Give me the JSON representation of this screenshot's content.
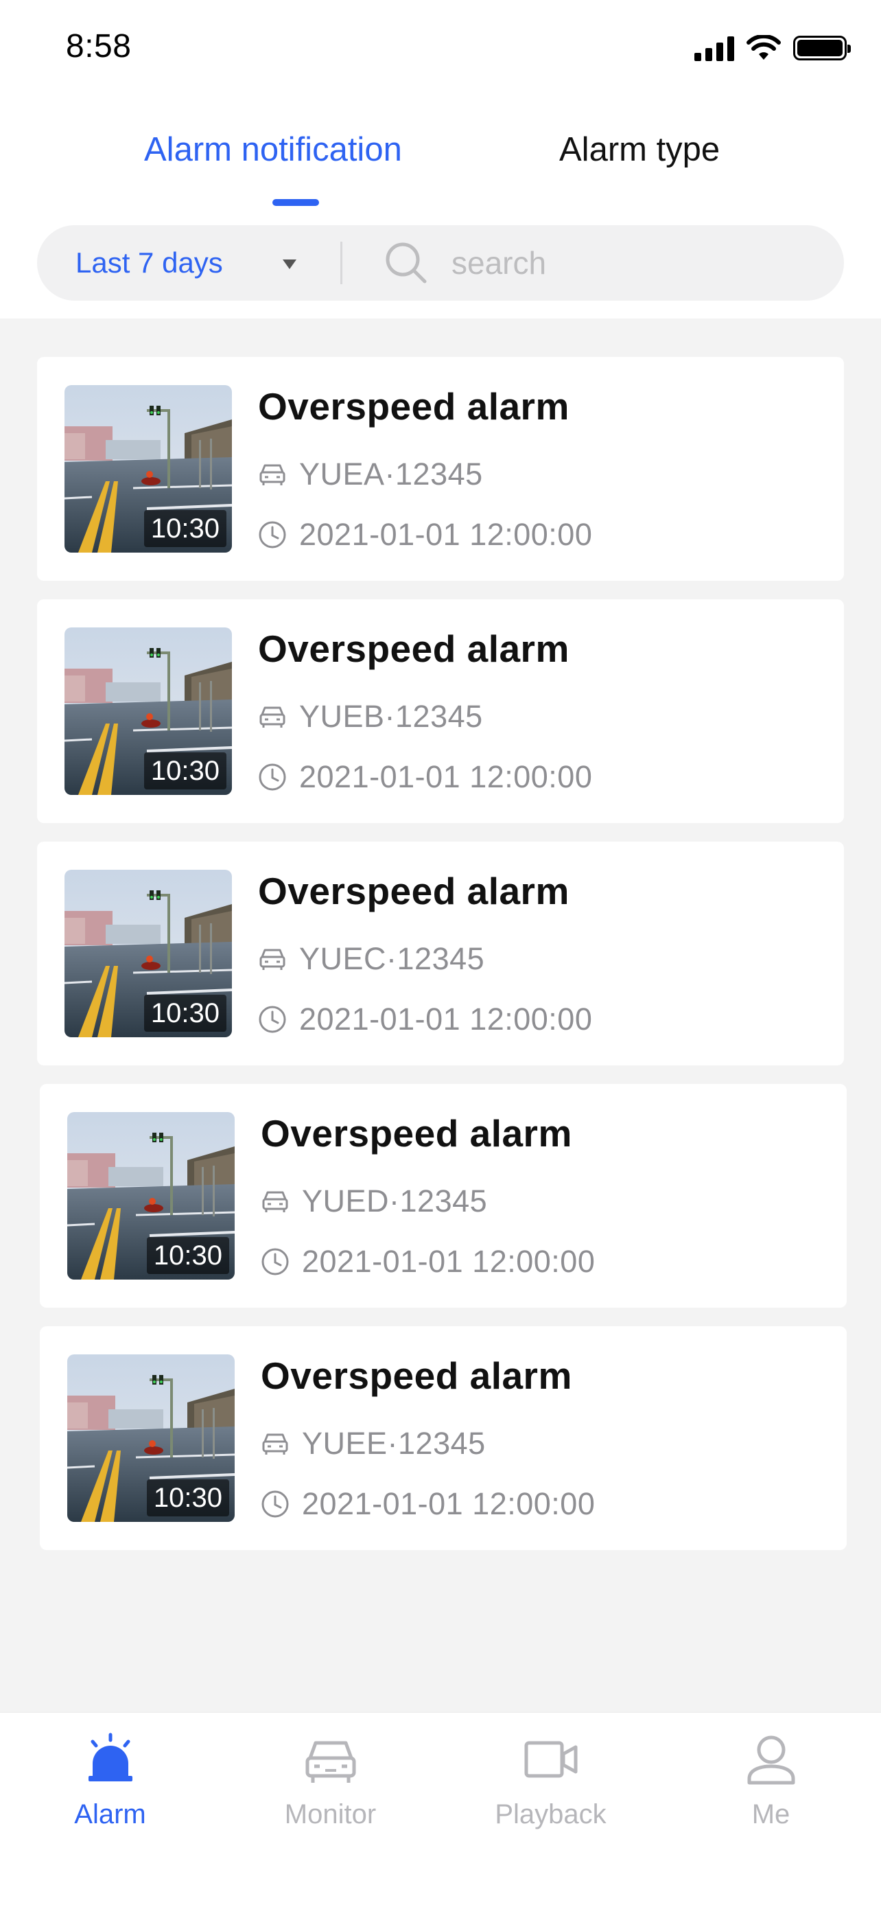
{
  "status_bar": {
    "time": "8:58"
  },
  "tabs": [
    {
      "label": "Alarm notification",
      "active": true
    },
    {
      "label": "Alarm type",
      "active": false
    }
  ],
  "filter": {
    "range_label": "Last 7 days",
    "search_placeholder": "search",
    "search_value": ""
  },
  "alarms": [
    {
      "title": "Overspeed alarm",
      "duration": "10:30",
      "plate": "YUEA·12345",
      "datetime": "2021-01-01 12:00:00"
    },
    {
      "title": "Overspeed alarm",
      "duration": "10:30",
      "plate": "YUEB·12345",
      "datetime": "2021-01-01 12:00:00"
    },
    {
      "title": "Overspeed alarm",
      "duration": "10:30",
      "plate": "YUEC·12345",
      "datetime": "2021-01-01 12:00:00"
    },
    {
      "title": "Overspeed alarm",
      "duration": "10:30",
      "plate": "YUED·12345",
      "datetime": "2021-01-01 12:00:00"
    },
    {
      "title": "Overspeed alarm",
      "duration": "10:30",
      "plate": "YUEE·12345",
      "datetime": "2021-01-01 12:00:00"
    }
  ],
  "bottom_nav": [
    {
      "label": "Alarm",
      "icon": "alarm-siren-icon",
      "active": true
    },
    {
      "label": "Monitor",
      "icon": "car-icon",
      "active": false
    },
    {
      "label": "Playback",
      "icon": "video-camera-icon",
      "active": false
    },
    {
      "label": "Me",
      "icon": "user-icon",
      "active": false
    }
  ],
  "colors": {
    "accent": "#2e63f2",
    "page_background": "#f3f3f3",
    "card_background": "#ffffff",
    "muted_text": "#8e8e92",
    "inactive_nav": "#b6b6ba"
  }
}
